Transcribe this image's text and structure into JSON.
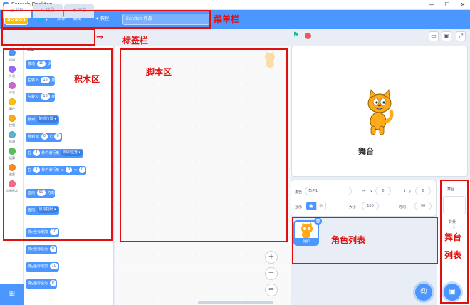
{
  "window": {
    "title": "Scratch Desktop",
    "min": "—",
    "max": "☐",
    "close": "✕"
  },
  "menubar": {
    "logo": "Scratch",
    "language_icon": "🌐",
    "file": "文件",
    "edit": "编辑",
    "tutorials": "教程",
    "project_title": "Scratch 作品"
  },
  "tabs": [
    {
      "label": "代码"
    },
    {
      "label": "造型"
    },
    {
      "label": "声音"
    }
  ],
  "categories": [
    {
      "label": "运动",
      "color": "#4c97ff"
    },
    {
      "label": "外观",
      "color": "#9966ff"
    },
    {
      "label": "声音",
      "color": "#cf63cf"
    },
    {
      "label": "事件",
      "color": "#ffbf00"
    },
    {
      "label": "控制",
      "color": "#ffab19"
    },
    {
      "label": "侦测",
      "color": "#5cb1d6"
    },
    {
      "label": "运算",
      "color": "#59c059"
    },
    {
      "label": "变量",
      "color": "#ff8c1a"
    },
    {
      "label": "自制积木",
      "color": "#ff6680"
    }
  ],
  "palette": {
    "heading": "运动",
    "move": {
      "a": "移动",
      "v": "10",
      "b": "步"
    },
    "turn_right": {
      "a": "右转",
      "v": "15",
      "b": "度"
    },
    "turn_left": {
      "a": "左转",
      "v": "15",
      "b": "度"
    },
    "goto": {
      "a": "移到",
      "v": "随机位置 ▾"
    },
    "gotoxy": {
      "a": "移到 x:",
      "x": "0",
      "b": "y:",
      "y": "0"
    },
    "glide": {
      "a": "在",
      "v": "1",
      "b": "秒内滑行到",
      "c": "随机位置 ▾"
    },
    "glidexy": {
      "a": "在",
      "v": "1",
      "b": "秒内滑行到 x:",
      "x": "0",
      "c": "y:",
      "y": "0"
    },
    "point": {
      "a": "面向",
      "v": "90",
      "b": "方向"
    },
    "pointto": {
      "a": "面向",
      "v": "鼠标指针 ▾"
    },
    "changex": {
      "a": "将x坐标增加",
      "v": "10"
    },
    "setx": {
      "a": "将x坐标设为",
      "v": "0"
    },
    "changey": {
      "a": "将y坐标增加",
      "v": "10"
    },
    "sety": {
      "a": "将y坐标设为",
      "v": "0"
    }
  },
  "sprite": {
    "sprite_label": "角色",
    "sprite_name": "角色1",
    "x_label": "x",
    "x_value": "0",
    "y_label": "y",
    "y_value": "0",
    "show_label": "显示",
    "size_label": "大小",
    "size_value": "100",
    "direction_label": "方向",
    "direction_value": "90",
    "thumb_name": "角色1"
  },
  "stage_panel": {
    "title": "舞台",
    "backdrops_label": "背景",
    "backdrops_count": "1"
  },
  "annotations": {
    "menubar": "菜单栏",
    "tabs": "标签栏",
    "blocks": "积木区",
    "scripts": "脚本区",
    "stage": "舞台",
    "sprites": "角色列表",
    "stagelist_1": "舞台",
    "stagelist_2": "列表"
  }
}
